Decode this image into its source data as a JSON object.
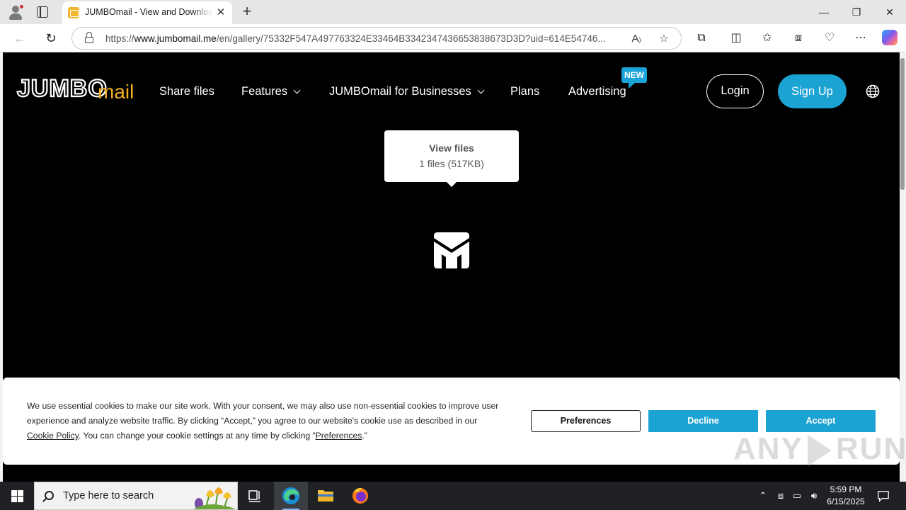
{
  "browser": {
    "tab_title": "JUMBOmail - View and Download Files",
    "tab_close": "✕",
    "new_tab": "+",
    "url_prefix": "https://",
    "url_host": "www.jumbomail.me",
    "url_path": "/en/gallery/75332F547A497763324E33464B3342347436653838673D3D?uid=614E54746...",
    "window": {
      "minimize": "—",
      "restore": "❐",
      "close": "✕"
    }
  },
  "site": {
    "logo_main": "JUMBO",
    "logo_sub": "mail",
    "nav": [
      {
        "label": "Share files"
      },
      {
        "label": "Features"
      },
      {
        "label": "JUMBOmail for Businesses"
      },
      {
        "label": "Plans"
      },
      {
        "label": "Advertising"
      }
    ],
    "new_badge": "NEW",
    "login": "Login",
    "signup": "Sign Up",
    "tooltip": {
      "title": "View files",
      "subtitle": "1 files (517KB)"
    }
  },
  "cookie": {
    "text_1": "We use essential cookies to make our site work. With your consent, we may also use non-essential cookies to improve user experience and analyze website traffic. By clicking “Accept,” you agree to our website's cookie use as described in our ",
    "link_policy": "Cookie Policy",
    "text_2": ". You can change your cookie settings at any time by clicking “",
    "link_prefs": "Preferences",
    "text_3": ".”",
    "preferences": "Preferences",
    "decline": "Decline",
    "accept": "Accept"
  },
  "watermark": {
    "left": "ANY",
    "right": "RUN"
  },
  "taskbar": {
    "search_placeholder": "Type here to search",
    "time": "5:59 PM",
    "date": "6/15/2025"
  },
  "colors": {
    "brand_blue": "#1BA3D3",
    "brand_yellow": "#F5B01E",
    "site_background": "#000000"
  }
}
